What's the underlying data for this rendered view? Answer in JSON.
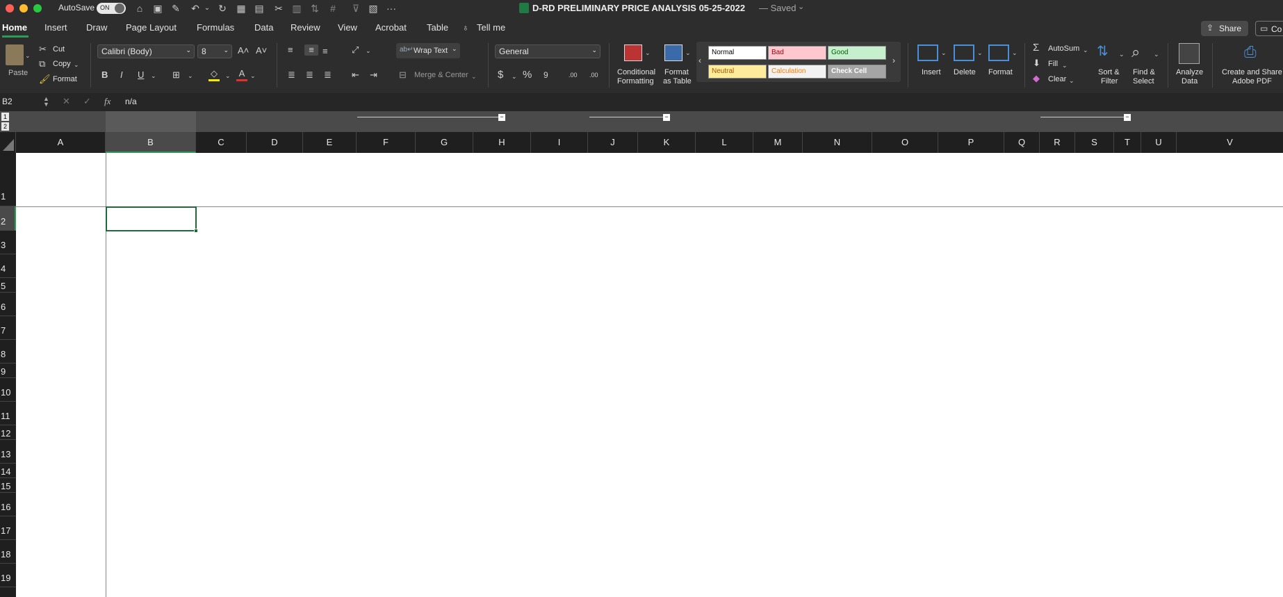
{
  "title_bar": {
    "autosave_label": "AutoSave",
    "autosave_state": "ON",
    "document_title": "D-RD PRELIMINARY PRICE ANALYSIS 05-25-2022",
    "saved_status": "— Saved",
    "more": "···"
  },
  "tabs": [
    "Home",
    "Insert",
    "Draw",
    "Page Layout",
    "Formulas",
    "Data",
    "Review",
    "View",
    "Acrobat",
    "Table"
  ],
  "tell_me": "Tell me",
  "share_label": "Share",
  "comments_label": "Co",
  "clipboard": {
    "paste": "Paste",
    "cut": "Cut",
    "copy": "Copy",
    "format": "Format"
  },
  "font": {
    "name": "Calibri (Body)",
    "size": "8",
    "bold": "B",
    "italic": "I",
    "underline": "U",
    "font_color_glyph": "A"
  },
  "alignment": {
    "wrap_text": "Wrap Text",
    "merge_center": "Merge & Center"
  },
  "number": {
    "format": "General",
    "currency": "$",
    "percent": "%",
    "comma": "9",
    "inc_decimal": ".00",
    "dec_decimal": ".00"
  },
  "styles": {
    "conditional_formatting": [
      "Conditional",
      "Formatting"
    ],
    "format_as_table": [
      "Format",
      "as Table"
    ],
    "cells": [
      {
        "label": "Normal",
        "bg": "#ffffff",
        "fg": "#000000"
      },
      {
        "label": "Bad",
        "bg": "#ffc7ce",
        "fg": "#9c0006"
      },
      {
        "label": "Good",
        "bg": "#c6efce",
        "fg": "#006100"
      },
      {
        "label": "Neutral",
        "bg": "#ffeb9c",
        "fg": "#9c5700"
      },
      {
        "label": "Calculation",
        "bg": "#f2f2f2",
        "fg": "#fa7d00"
      },
      {
        "label": "Check Cell",
        "bg": "#a5a5a5",
        "fg": "#ffffff"
      }
    ]
  },
  "cells_group": {
    "insert": "Insert",
    "delete": "Delete",
    "format": "Format"
  },
  "editing": {
    "autosum": "AutoSum",
    "fill": "Fill",
    "clear": "Clear",
    "sort_filter": [
      "Sort &",
      "Filter"
    ],
    "find_select": [
      "Find &",
      "Select"
    ]
  },
  "analyze_data": [
    "Analyze",
    "Data"
  ],
  "create_share_pdf": [
    "Create and Share",
    "Adobe PDF"
  ],
  "formula_bar": {
    "name_box": "B2",
    "fx": "fx",
    "content": "n/a"
  },
  "outline_levels": [
    "1",
    "2"
  ],
  "columns": [
    "A",
    "B",
    "C",
    "D",
    "E",
    "F",
    "G",
    "H",
    "I",
    "J",
    "K",
    "L",
    "M",
    "N",
    "O",
    "P",
    "Q",
    "R",
    "S",
    "T",
    "U",
    "V"
  ],
  "rows": [
    "1",
    "2",
    "3",
    "4",
    "5",
    "6",
    "7",
    "8",
    "9",
    "10",
    "11",
    "12",
    "13",
    "14",
    "15",
    "16",
    "17",
    "18",
    "19"
  ],
  "colors": {
    "selection": "#1e6b3a",
    "chrome": "#2d2d2d",
    "header": "#1f1f1f"
  }
}
